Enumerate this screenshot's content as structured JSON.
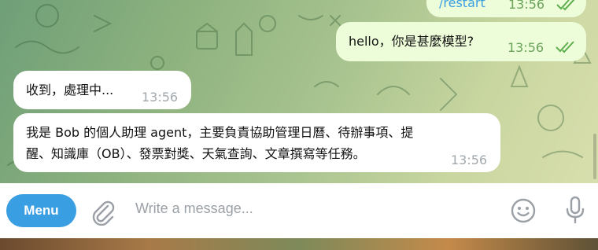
{
  "messages": {
    "out1": {
      "text": "/restart",
      "time": "13:56"
    },
    "out2": {
      "text": "hello，你是甚麼模型?",
      "time": "13:56"
    },
    "in1": {
      "text": "收到，處理中...",
      "time": "13:56"
    },
    "in2": {
      "line1": "我是 Bob 的個人助理 agent，主要負責協助管理日曆、待辦事項、提",
      "line2": "醒、知識庫（OB）、發票對獎、天氣查詢、文章撰寫等任務。",
      "time": "13:56"
    }
  },
  "composer": {
    "menu_label": "Menu",
    "placeholder": "Write a message..."
  },
  "icons": {
    "attach": "paperclip-icon",
    "emoji": "emoji-icon",
    "mic": "microphone-icon",
    "read": "double-check-icon"
  },
  "colors": {
    "accent": "#3a9ee2",
    "outgoing_bubble": "#eefdd9",
    "incoming_bubble": "#ffffff",
    "read_check": "#5fae4f"
  }
}
